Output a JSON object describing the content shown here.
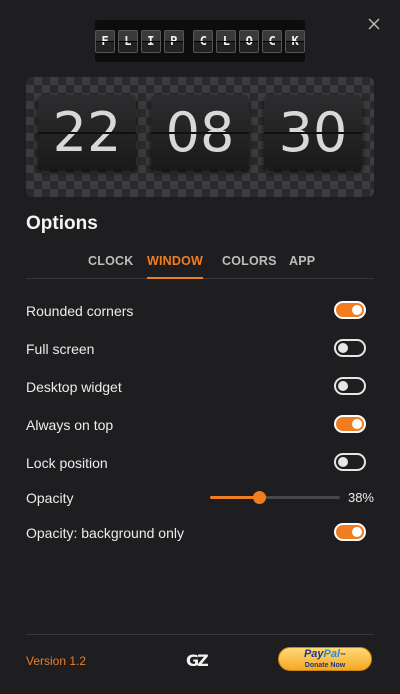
{
  "app": {
    "logo_letters": [
      "F",
      "L",
      "I",
      "P",
      "C",
      "L",
      "O",
      "C",
      "K"
    ]
  },
  "clock": {
    "hours": "22",
    "minutes": "08",
    "seconds": "30"
  },
  "options": {
    "title": "Options",
    "tabs": [
      {
        "label": "CLOCK",
        "active": false
      },
      {
        "label": "WINDOW",
        "active": true
      },
      {
        "label": "COLORS",
        "active": false
      },
      {
        "label": "APP",
        "active": false
      }
    ],
    "rows": [
      {
        "label": "Rounded corners",
        "on": true
      },
      {
        "label": "Full screen",
        "on": false
      },
      {
        "label": "Desktop widget",
        "on": false
      },
      {
        "label": "Always on top",
        "on": true
      },
      {
        "label": "Lock position",
        "on": false
      }
    ],
    "opacity": {
      "label": "Opacity",
      "value_percent": 38,
      "value_text": "38%"
    },
    "opacity_bg": {
      "label": "Opacity: background only",
      "on": true
    }
  },
  "footer": {
    "version": "Version 1.2",
    "gz_logo": "GZ",
    "paypal_brand_1": "Pay",
    "paypal_brand_2": "Pal",
    "paypal_tm": "™",
    "paypal_donate": "Donate Now"
  },
  "colors": {
    "accent": "#f07d22",
    "background": "#1e1e20"
  }
}
